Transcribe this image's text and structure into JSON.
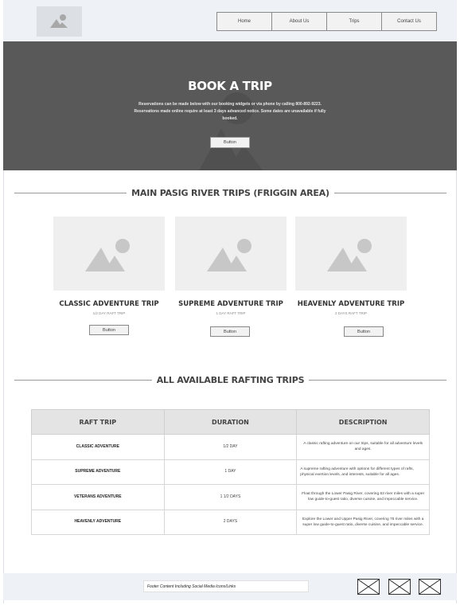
{
  "nav": {
    "items": [
      {
        "label": "Home"
      },
      {
        "label": "About Us"
      },
      {
        "label": "Trips"
      },
      {
        "label": "Contact Us"
      }
    ]
  },
  "hero": {
    "title": "BOOK A TRIP",
    "text": "Reservations can be made below with our booking widgets or via phone by calling 800-892-9223. Reservations made online require at least 3 days advanced notice. Some dates are unavailable if fully booked.",
    "button_label": "Button"
  },
  "section1": {
    "heading": "MAIN PASIG RIVER TRIPS (FRIGGIN AREA)",
    "cards": [
      {
        "title": "CLASSIC ADVENTURE TRIP",
        "subtitle": "1/2 DAY RAFT TRIP",
        "button_label": "Button"
      },
      {
        "title": "SUPREME ADVENTURE TRIP",
        "subtitle": "1 DAY RAFT TRIP",
        "button_label": "Button"
      },
      {
        "title": "HEAVENLY ADVENTURE TRIP",
        "subtitle": "2 DAYS RAFT TRIP",
        "button_label": "Button"
      }
    ]
  },
  "section2": {
    "heading": "ALL AVAILABLE RAFTING TRIPS",
    "table": {
      "headers": [
        "RAFT TRIP",
        "DURATION",
        "DESCRIPTION"
      ],
      "rows": [
        [
          "CLASSIC ADVENTURE",
          "1/2 DAY",
          "A classic rafting adventure on our trips, suitable for all adventure levels and ages."
        ],
        [
          "SUPREME ADVENTURE",
          "1 DAY",
          "A supreme rafting adventure with options for different types of rafts, physical exertion levels, and interests, suitable for all ages."
        ],
        [
          "VETERANS ADVENTURE",
          "1 1/2 DAYS",
          "Float through the Lower Pasig River, covering 63 river miles with a super low guide-to-guest ratio, diverse cuisine, and impeccable service."
        ],
        [
          "HEAVENLY ADVENTURE",
          "2 DAYS",
          "Explore the Lower and Upper Pasig River, covering 75 river miles with a super low guide-to-guest ratio, diverse cuisine, and impeccable service."
        ]
      ]
    }
  },
  "footer": {
    "text": "Footer Content Including Social Media Icons/Links"
  },
  "icons": {
    "logo": "image-placeholder-icon",
    "card_image": "image-placeholder-icon",
    "social": "social-placeholder-icon"
  }
}
